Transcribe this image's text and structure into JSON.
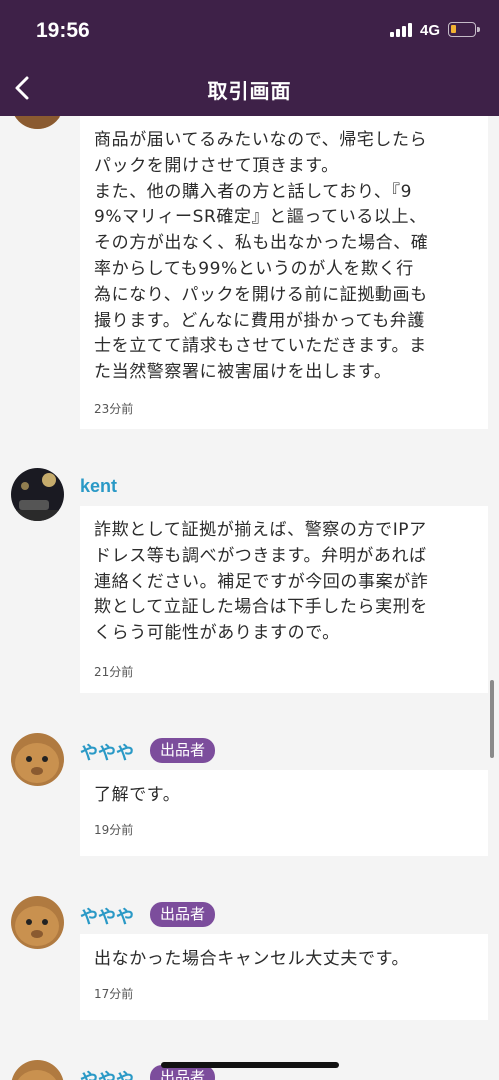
{
  "status": {
    "time": "19:56",
    "network": "4G",
    "battery_color": "#f2b233"
  },
  "header": {
    "title": "取引画面",
    "back_icon": "chevron-left-icon",
    "background": "#3e2148"
  },
  "messages": [
    {
      "lines": [
        "商品が届いてるみたいなので、帰宅したら",
        "パックを開けさせて頂きます。",
        "また、他の購入者の方と話しており、『9",
        "9%マリィーSR確定』と謳っている以上、",
        "その方が出なく、私も出なかった場合、確",
        "率からしても99%というのが人を欺く行",
        "為になり、パックを開ける前に証拠動画も",
        "撮ります。どんなに費用が掛かっても弁護",
        "士を立てて請求もさせていただきます。ま",
        "た当然警察署に被害届けを出します。"
      ],
      "time": "23分前"
    },
    {
      "user": "kent",
      "lines": [
        "詐欺として証拠が揃えば、警察の方でIPア",
        "ドレス等も調べがつきます。弁明があれば",
        "連絡ください。補足ですが今回の事案が詐",
        "欺として立証した場合は下手したら実刑を",
        "くらう可能性がありますので。"
      ],
      "time": "21分前"
    },
    {
      "user": "ややや",
      "badge": "出品者",
      "lines": [
        "了解です。"
      ],
      "time": "19分前"
    },
    {
      "user": "ややや",
      "badge": "出品者",
      "lines": [
        "出なかった場合キャンセル大丈夫です。"
      ],
      "time": "17分前"
    },
    {
      "user": "ややや",
      "badge": "出品者"
    }
  ],
  "colors": {
    "username": "#2a99c6",
    "badge": "#7c4d9c",
    "page_bg": "#f4f4f4"
  }
}
